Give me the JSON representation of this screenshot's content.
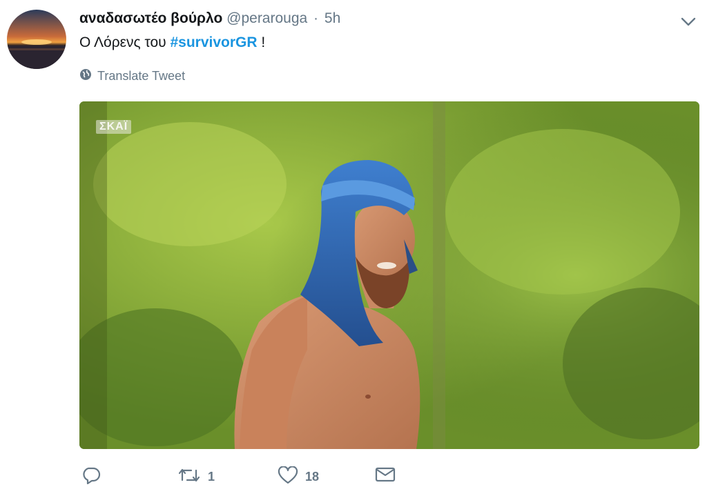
{
  "tweet": {
    "author_name": "αναδασωτέο βούρλο",
    "handle": "@perarouga",
    "separator": "·",
    "time": "5h",
    "text_before": "Ο Λόρενς του ",
    "hashtag": "#survivorGR",
    "text_after": " !",
    "translate_label": "Translate Tweet",
    "media_overlay_logo": "ΣΚΑΪ",
    "replies": "",
    "retweets": "1",
    "likes": "18"
  },
  "icons": {
    "caret": "chevron-down-icon",
    "globe": "globe-icon",
    "reply": "reply-icon",
    "retweet": "retweet-icon",
    "like": "heart-icon",
    "message": "envelope-icon"
  },
  "colors": {
    "hashtag": "#1b95e0",
    "secondary_text": "#657786",
    "primary_text": "#14171a"
  }
}
